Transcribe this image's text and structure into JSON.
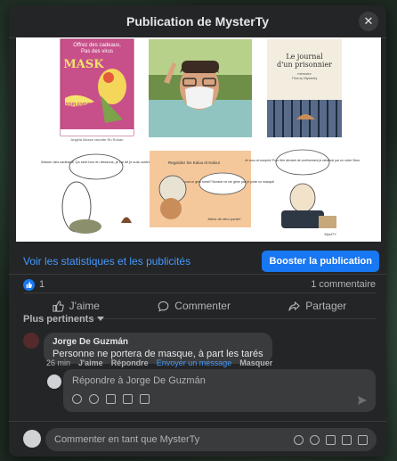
{
  "modal": {
    "title": "Publication de MysterTy",
    "close_icon": "✕"
  },
  "image": {
    "book1": {
      "line1": "Offrez des cadeaux,",
      "line2": "Pas des virus",
      "word": "MASK",
      "exclaim": "SSSPLENDIDE!",
      "footer": "Angela Mosse raconte Ru Rohan"
    },
    "book3": {
      "title1": "Le journal",
      "title2": "d'un prisonnier",
      "author1": "mémoire",
      "author2": "Thierry Mysterty"
    },
    "bubble_left": "Waouh des cadeaux! Ça sent bon en dessous, je l'ai dit je suis contre!",
    "bubble_mid": "C'est qui sous ce gros fumet? Bonsoir ne me gêne pas je porte un masque!",
    "bubble_right": "Je vous ai compris! Pour être déclaré de confinement je rabattrai par un ordre Sieur.",
    "caption_mid": "Regardez les Kalou et Kalou!",
    "caption_mid2": "Merci de zéro porter!",
    "signature": "MystTY"
  },
  "stats": {
    "link": "Voir les statistiques et les publicités",
    "boost": "Booster la publication"
  },
  "reactions": {
    "count": "1",
    "comments": "1 commentaire"
  },
  "actions": {
    "like": "J'aime",
    "comment": "Commenter",
    "share": "Partager"
  },
  "sort": {
    "label": "Plus pertinents"
  },
  "comment": {
    "name": "Jorge De Guzmán",
    "text": "Personne ne portera de masque, à part les tarés",
    "age": "26 min",
    "like": "J'aime",
    "reply": "Répondre",
    "message": "Envoyer un message",
    "hide": "Masquer"
  },
  "reply_box": {
    "placeholder": "Répondre à Jorge De Guzmán"
  },
  "bottom": {
    "placeholder": "Commenter en tant que MysterTy"
  }
}
